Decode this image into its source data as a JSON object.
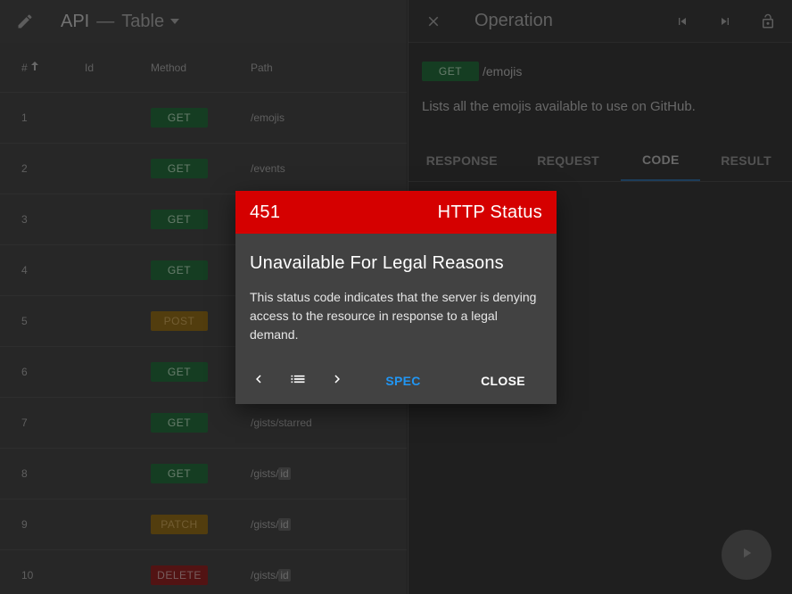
{
  "left": {
    "title_api": "API",
    "title_sep": "—",
    "title_view": "Table",
    "columns": {
      "num": "#",
      "id": "Id",
      "method": "Method",
      "path": "Path"
    },
    "rows": [
      {
        "num": "1",
        "method": "GET",
        "path": "/emojis",
        "param": ""
      },
      {
        "num": "2",
        "method": "GET",
        "path": "/events",
        "param": ""
      },
      {
        "num": "3",
        "method": "GET",
        "path": "",
        "param": ""
      },
      {
        "num": "4",
        "method": "GET",
        "path": "",
        "param": ""
      },
      {
        "num": "5",
        "method": "POST",
        "path": "",
        "param": ""
      },
      {
        "num": "6",
        "method": "GET",
        "path": "",
        "param": ""
      },
      {
        "num": "7",
        "method": "GET",
        "path": "/gists/starred",
        "param": ""
      },
      {
        "num": "8",
        "method": "GET",
        "path": "/gists/",
        "param": "id"
      },
      {
        "num": "9",
        "method": "PATCH",
        "path": "/gists/",
        "param": "id"
      },
      {
        "num": "10",
        "method": "DELETE",
        "path": "/gists/",
        "param": "id"
      }
    ]
  },
  "right": {
    "title": "Operation",
    "method": "GET",
    "path": "/emojis",
    "description": "Lists all the emojis available to use on GitHub.",
    "tabs": [
      "RESPONSE",
      "REQUEST",
      "CODE",
      "RESULT"
    ],
    "active_tab": "CODE"
  },
  "dialog": {
    "code": "451",
    "header_label": "HTTP Status",
    "title": "Unavailable For Legal Reasons",
    "body": "This status code indicates that the server is denying access to the resource in response to a legal demand.",
    "spec_label": "SPEC",
    "close_label": "CLOSE"
  },
  "colors": {
    "dialog_header": "#d50000",
    "spec_accent": "#2196f3",
    "get": "#1f5a33",
    "post": "#7a5a16",
    "delete": "#7a1c1c"
  }
}
